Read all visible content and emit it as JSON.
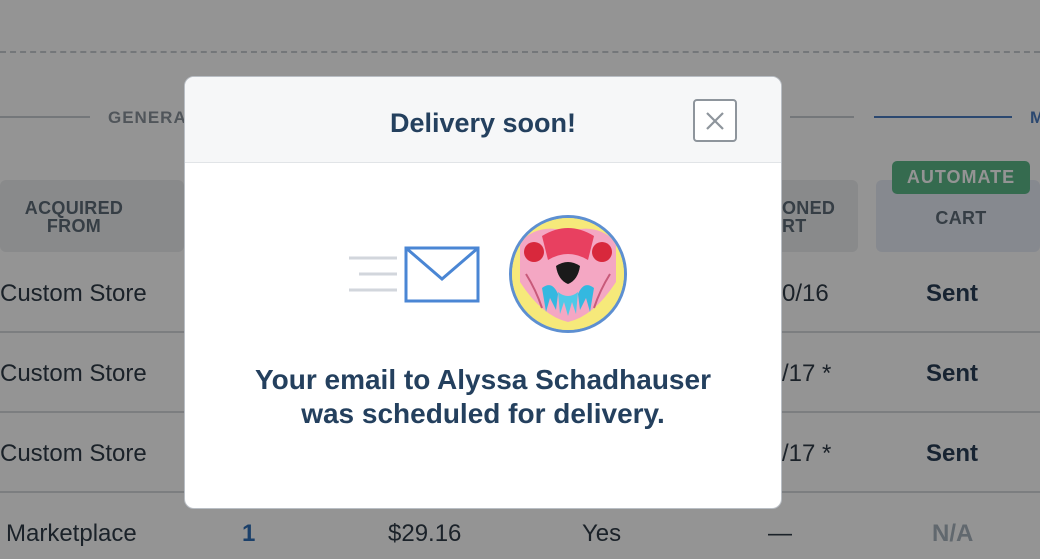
{
  "background": {
    "sections": {
      "general_label": "GENERA",
      "right_label": "M"
    },
    "automate_badge": "AUTOMATE",
    "headers": {
      "acquired_from_line1": "ACQUIRED",
      "acquired_from_line2": "FROM",
      "partial_line1": "ONED",
      "partial_line2": "RT",
      "cart": "CART"
    },
    "rows": [
      {
        "acquired_from": "Custom Store",
        "partial": "0/16",
        "cart": "Sent"
      },
      {
        "acquired_from": "Custom Store",
        "partial": "/17 *",
        "cart": "Sent"
      },
      {
        "acquired_from": "Custom Store",
        "partial": "/17 *",
        "cart": "Sent"
      },
      {
        "acquired_from": "Marketplace",
        "count": "1",
        "price": "$29.16",
        "flag": "Yes",
        "partial": "—",
        "cart": "N/A"
      }
    ]
  },
  "modal": {
    "title": "Delivery soon!",
    "message_line1": "Your email to Alyssa Schadhauser",
    "message_line2": "was scheduled for delivery.",
    "icons": {
      "close": "close-icon",
      "envelope": "envelope-icon",
      "avatar": "avatar"
    },
    "colors": {
      "title": "#24405e",
      "envelope": "#4a86d4",
      "avatar_border": "#5d8fd1"
    }
  }
}
